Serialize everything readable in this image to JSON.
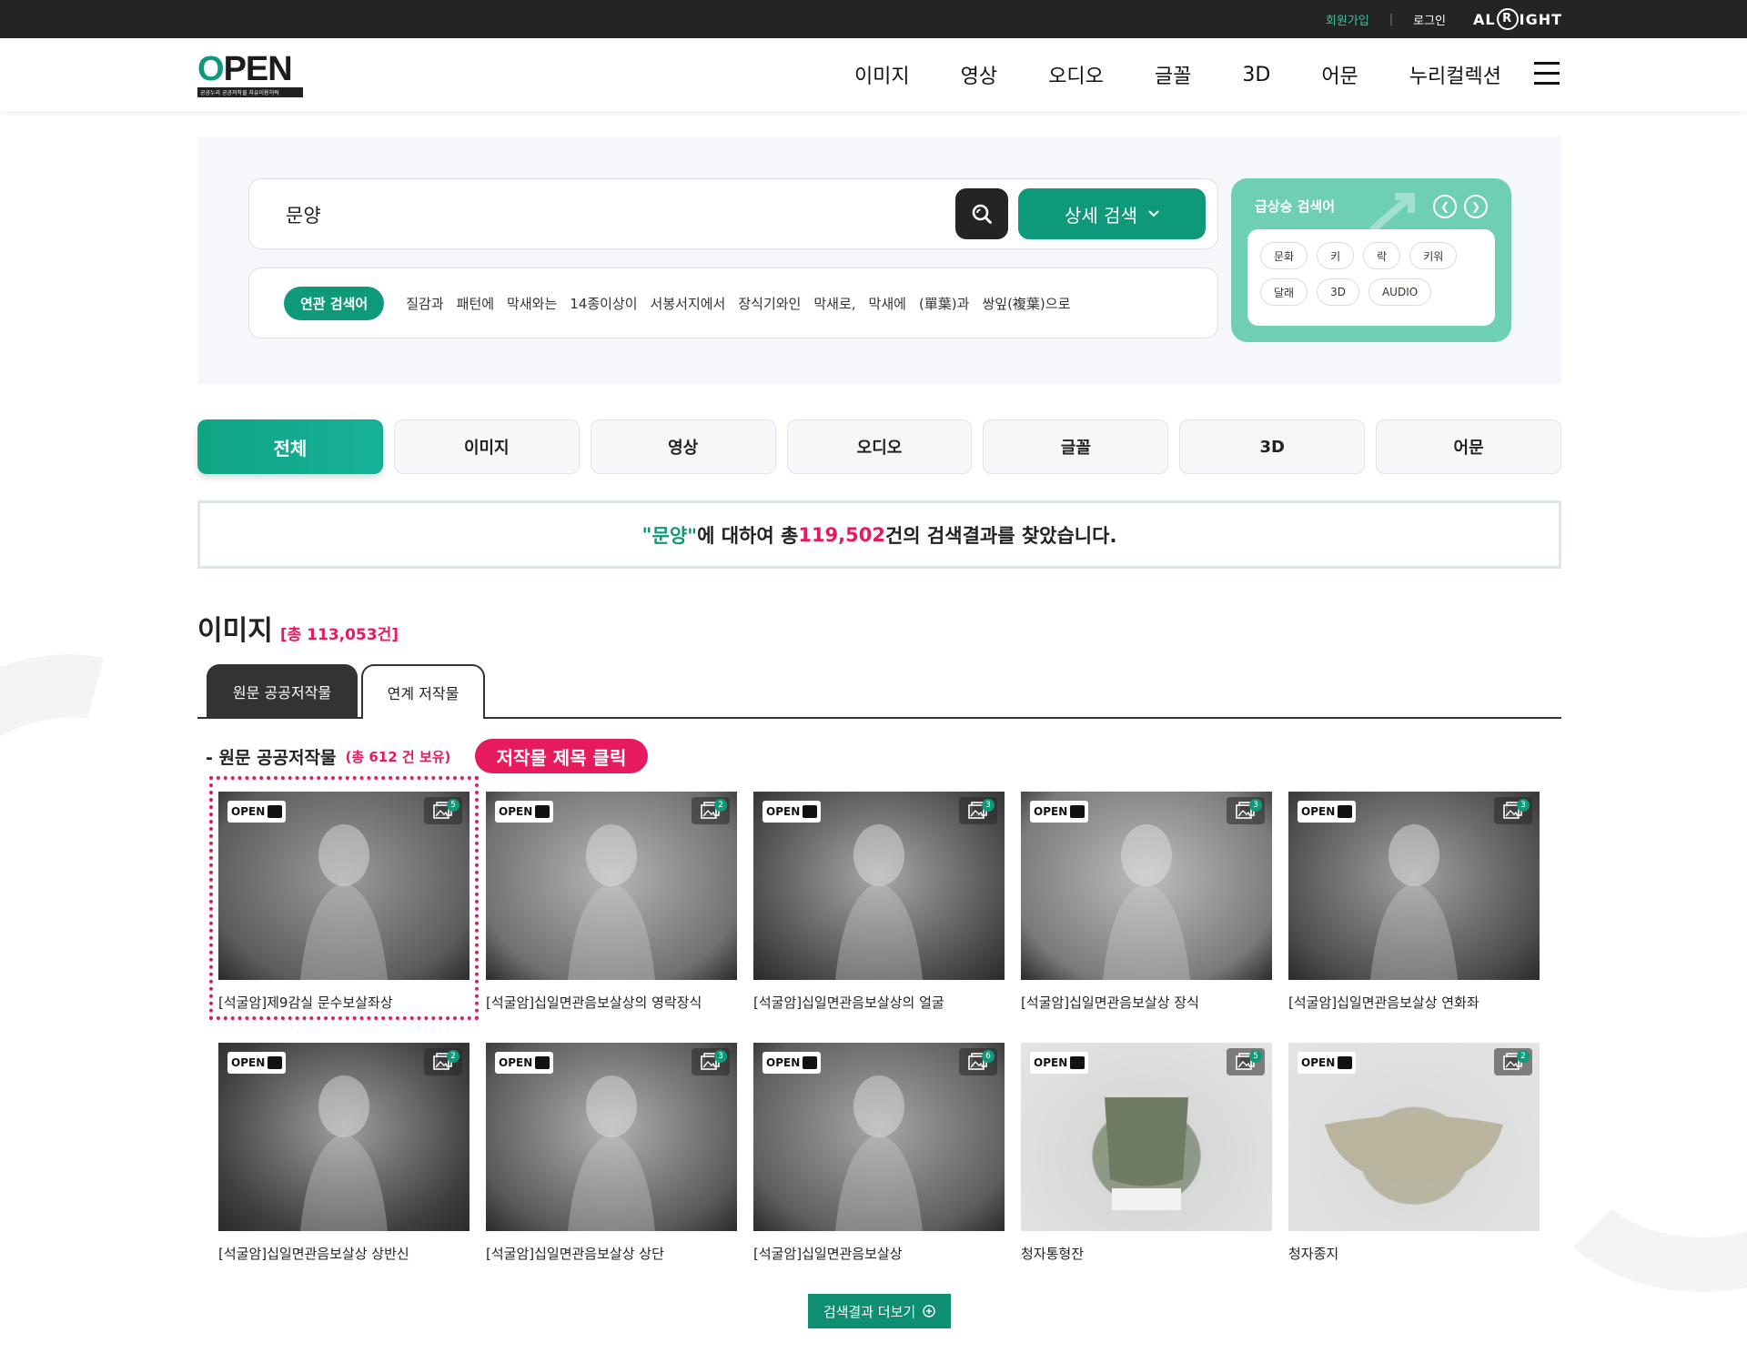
{
  "topbar": {
    "signup": "회원가입",
    "separator": "|",
    "login": "로그인",
    "alright_pre": "AL",
    "alright_r": "R",
    "alright_post": "IGHT"
  },
  "header": {
    "logo_text_o": "O",
    "logo_text_rest": "PEN",
    "logo_sub": "공공누리 공공저작물 자유이용허락",
    "nav": [
      "이미지",
      "영상",
      "오디오",
      "글꼴",
      "3D",
      "어문",
      "누리컬렉션"
    ]
  },
  "search": {
    "query": "문양",
    "detail_label": "상세 검색",
    "related_label": "연관 검색어",
    "related_terms": [
      "질감과",
      "패턴에",
      "막새와는",
      "14종이상이",
      "서봉서지에서",
      "장식기와인",
      "막새로,",
      "막새에",
      "(單葉)과",
      "쌍잎(複葉)으로"
    ]
  },
  "trending": {
    "title": "급상승 검색어",
    "terms": [
      "문화",
      "키",
      "락",
      "키워",
      "달래",
      "3D",
      "AUDIO"
    ]
  },
  "tabs": [
    "전체",
    "이미지",
    "영상",
    "오디오",
    "글꼴",
    "3D",
    "어문"
  ],
  "result": {
    "pre": "\"",
    "keyword": "문양",
    "mid": "\"에 대하여 총",
    "count": "119,502",
    "post": "건의 검색결과를 찾았습니다."
  },
  "image_section": {
    "title": "이미지",
    "count": "[총 113,053건]",
    "subtabs": [
      "원문 공공저작물",
      "연계 저작물"
    ],
    "owned_title": "- 원문 공공저작물",
    "owned_count": "(총 612 건 보유)",
    "click_badge": "저작물 제목 클릭",
    "items": [
      {
        "caption": "[석굴암]제9감실 문수보살좌상",
        "count": "5"
      },
      {
        "caption": "[석굴암]십일면관음보살상의 영락장식",
        "count": "2"
      },
      {
        "caption": "[석굴암]십일면관음보살상의 얼굴",
        "count": "3"
      },
      {
        "caption": "[석굴암]십일면관음보살상 장식",
        "count": "3"
      },
      {
        "caption": "[석굴암]십일면관음보살상 연화좌",
        "count": "3"
      },
      {
        "caption": "[석굴암]십일면관음보살상 상반신",
        "count": "2"
      },
      {
        "caption": "[석굴암]십일면관음보살상 상단",
        "count": "3"
      },
      {
        "caption": "[석굴암]십일면관음보살상",
        "count": "6"
      },
      {
        "caption": "청자통형잔",
        "count": "5"
      },
      {
        "caption": "청자종지",
        "count": "2"
      }
    ],
    "license_label": "OPEN",
    "more_label": "검색결과 더보기"
  }
}
